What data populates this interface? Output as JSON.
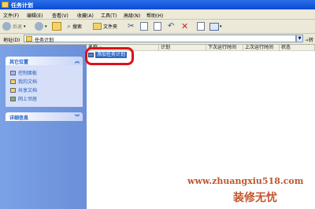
{
  "window": {
    "title": "任务计划"
  },
  "menu": [
    "文件(F)",
    "编辑(E)",
    "查看(V)",
    "收藏(A)",
    "工具(T)",
    "高级(N)",
    "帮助(H)"
  ],
  "toolbar": {
    "back": "后退",
    "search": "搜索",
    "folders": "文件夹"
  },
  "address": {
    "label": "地址(D)",
    "value": "任务计划",
    "go": "转到"
  },
  "taskpane": {
    "other_places": {
      "title": "其它位置",
      "links": [
        "控制面板",
        "我的文档",
        "共享文档",
        "网上邻居"
      ]
    },
    "details": {
      "title": "详细信息"
    }
  },
  "list": {
    "columns": [
      "名称",
      "计划",
      "下次运行时间",
      "上次运行时间",
      "状态"
    ],
    "items": [
      "添加任务计划"
    ]
  },
  "watermark": {
    "url": "www.zhuangxiu518.com",
    "name": "装修无忧"
  },
  "colors": {
    "accent": "#0a4bd6",
    "highlight": "#d8131b",
    "watermark": "#c2552b"
  }
}
